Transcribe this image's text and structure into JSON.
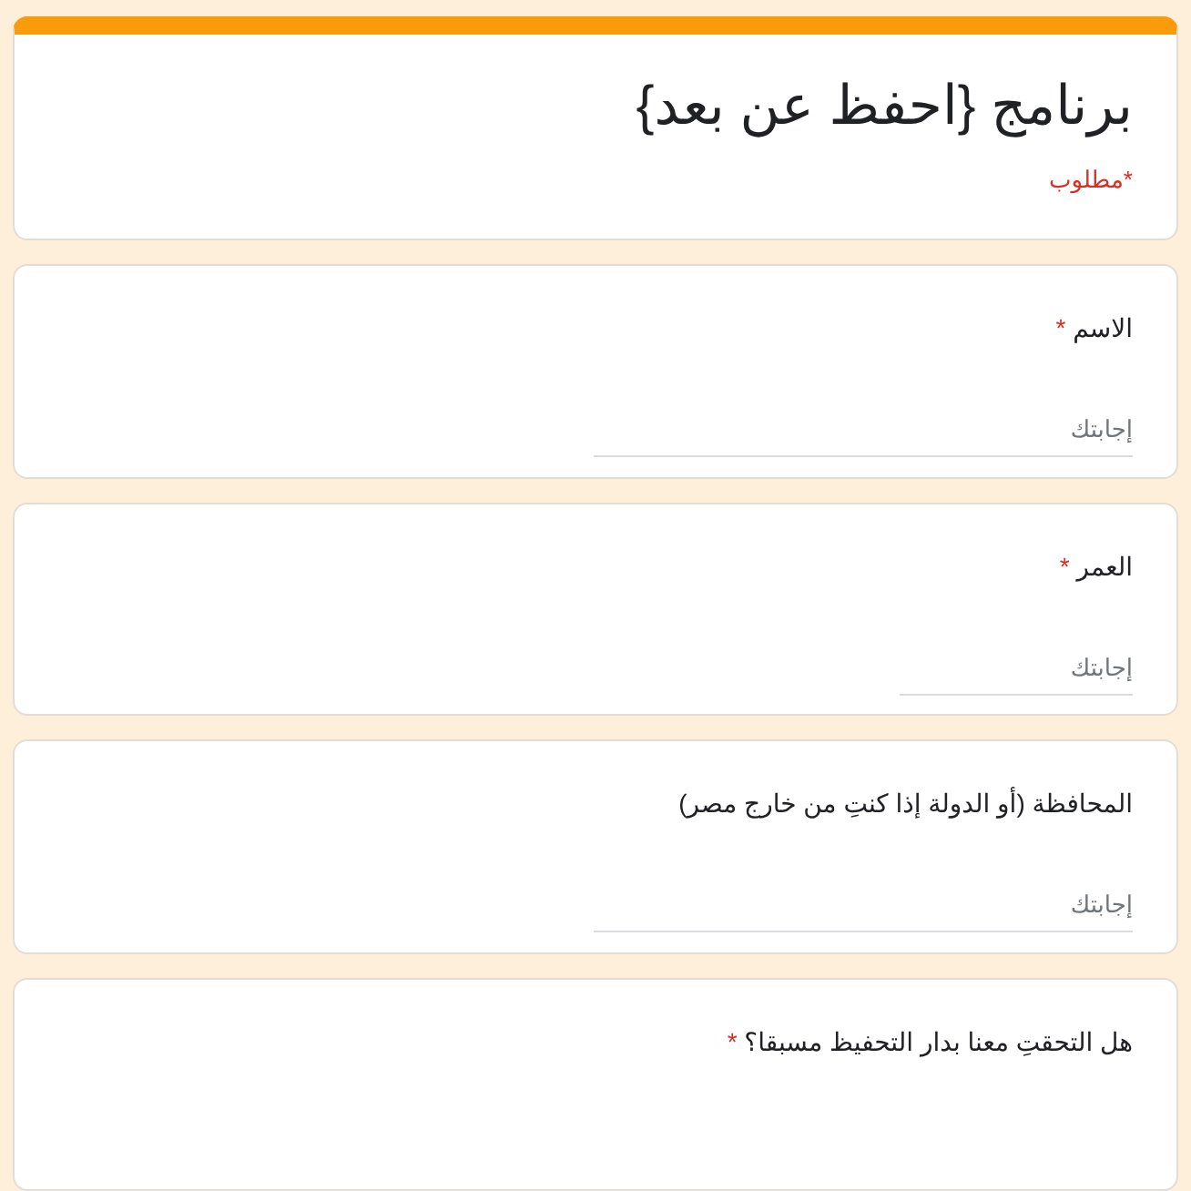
{
  "form": {
    "title": "برنامج {احفظ عن بعد}",
    "required_note": "*مطلوب"
  },
  "questions": [
    {
      "label": "الاسم",
      "required_mark": "*",
      "kind": "long",
      "placeholder": "إجابتك"
    },
    {
      "label": "العمر",
      "required_mark": "*",
      "kind": "short",
      "placeholder": "إجابتك"
    },
    {
      "label": "المحافظة (أو الدولة إذا كنتِ من خارج مصر)",
      "kind": "long",
      "placeholder": "إجابتك"
    },
    {
      "label": "هل التحقتِ معنا بدار التحفيظ مسبقا؟",
      "required_mark": "*",
      "kind": "none"
    }
  ]
}
